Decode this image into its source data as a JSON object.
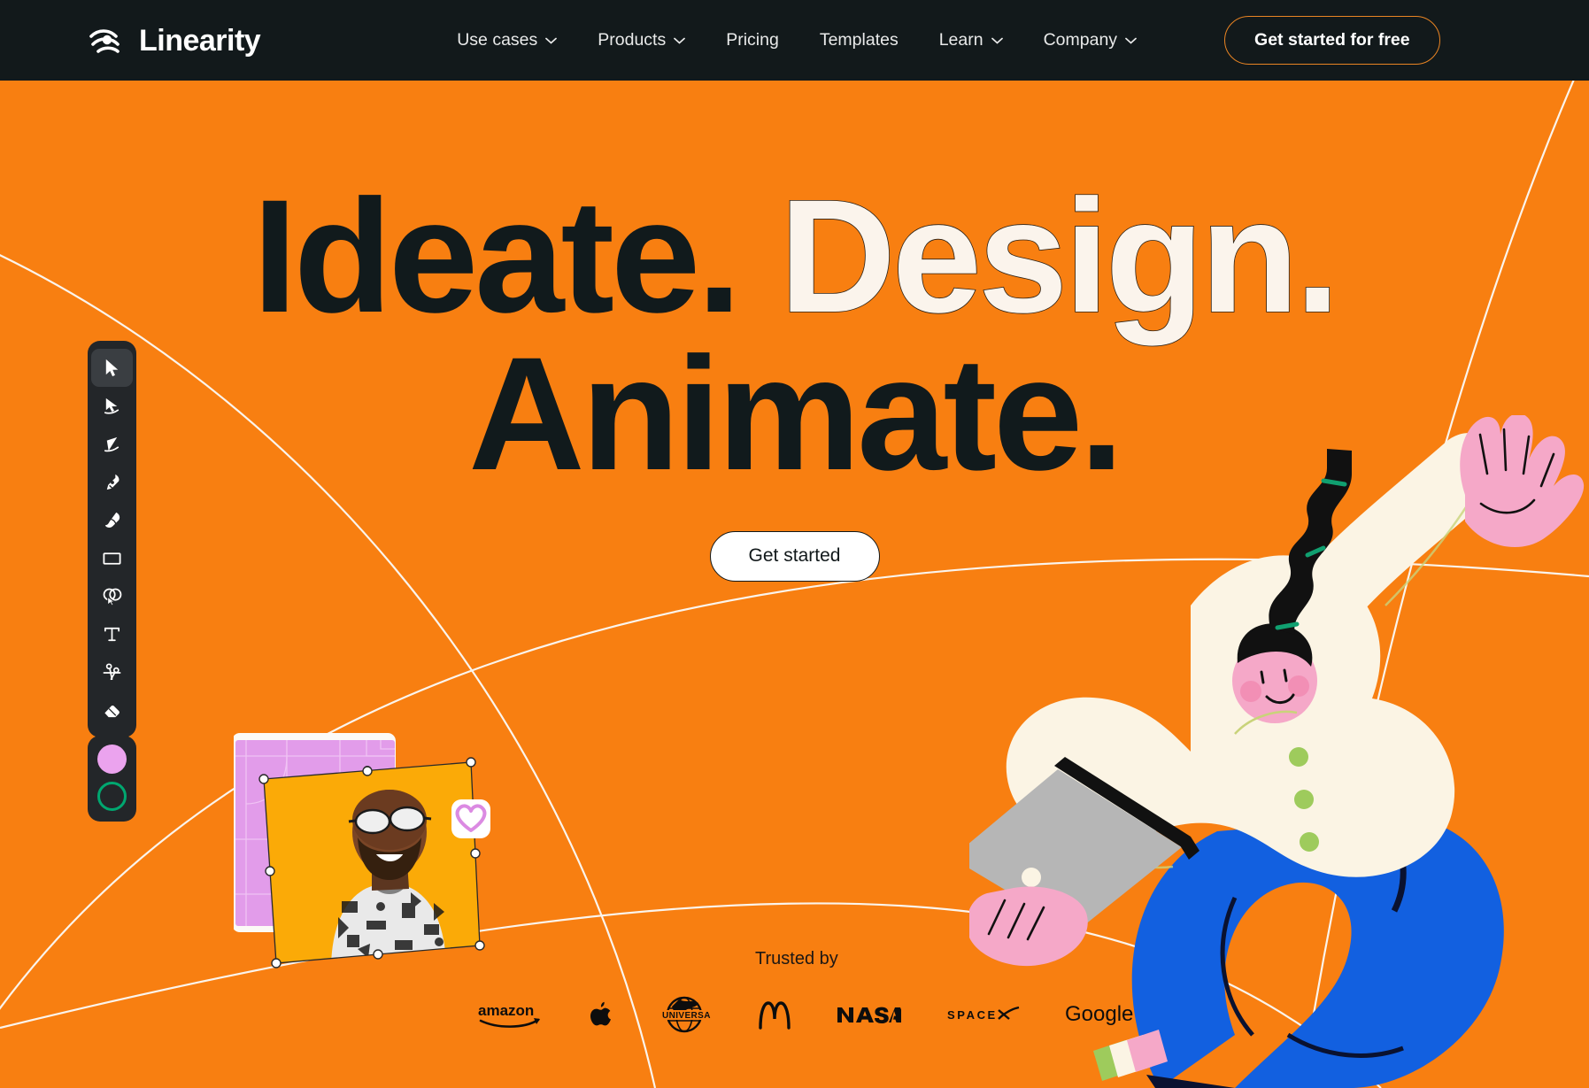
{
  "brand": {
    "name": "Linearity",
    "logo_icon": "linearity-swoosh-icon"
  },
  "colors": {
    "background_orange": "#F87F11",
    "header_dark": "#12191B",
    "headline_dark": "#111A1C",
    "headline_cream": "#FBF4EC",
    "cta_outline_border": "#E98423",
    "swatch_fill_pink": "#EBA3EE",
    "swatch_stroke_green": "#00A770",
    "illustration_blue": "#1260E0",
    "illustration_pink": "#F5A8C8",
    "photo_card_yellow": "#FBAA07",
    "grid_card_violet": "#E29CEA"
  },
  "header": {
    "nav_items": [
      {
        "label": "Use cases",
        "has_dropdown": true,
        "icon": "chevron-down-icon"
      },
      {
        "label": "Products",
        "has_dropdown": true,
        "icon": "chevron-down-icon"
      },
      {
        "label": "Pricing",
        "has_dropdown": false,
        "icon": ""
      },
      {
        "label": "Templates",
        "has_dropdown": false,
        "icon": ""
      },
      {
        "label": "Learn",
        "has_dropdown": true,
        "icon": "chevron-down-icon"
      },
      {
        "label": "Company",
        "has_dropdown": true,
        "icon": "chevron-down-icon"
      }
    ],
    "cta_label": "Get started for free"
  },
  "hero": {
    "line1_word1": "Ideate.",
    "line1_word2": "Design.",
    "line2": "Animate.",
    "cta_label": "Get started"
  },
  "toolbar": {
    "tools": [
      {
        "name": "selection-tool",
        "icon": "cursor-arrow-icon",
        "active": true
      },
      {
        "name": "node-tool",
        "icon": "direct-select-arrow-icon",
        "active": false
      },
      {
        "name": "lasso-tool",
        "icon": "lasso-triangle-icon",
        "active": false
      },
      {
        "name": "pen-tool",
        "icon": "pen-nib-icon",
        "active": false
      },
      {
        "name": "brush-tool",
        "icon": "paint-brush-icon",
        "active": false
      },
      {
        "name": "rectangle-tool",
        "icon": "rectangle-icon",
        "active": false
      },
      {
        "name": "shape-builder-tool",
        "icon": "shape-builder-icon",
        "active": false
      },
      {
        "name": "text-tool",
        "icon": "text-t-icon",
        "active": false
      },
      {
        "name": "scissors-tool",
        "icon": "scissors-icon",
        "active": false
      },
      {
        "name": "eraser-tool",
        "icon": "eraser-icon",
        "active": false
      }
    ],
    "swatches": [
      {
        "name": "fill-color-swatch",
        "type": "fill",
        "color": "#EBA3EE"
      },
      {
        "name": "stroke-color-swatch",
        "type": "stroke",
        "color": "#00A770"
      }
    ]
  },
  "canvas_cards": {
    "back_card": "white-card",
    "middle_card": "violet-grid-card",
    "front_card": "selected-photo-card",
    "badge_icon": "heart-icon",
    "selection_handles": 8
  },
  "trusted": {
    "label": "Trusted by",
    "logos": [
      {
        "name": "amazon",
        "icon": "amazon-wordmark-icon"
      },
      {
        "name": "Apple",
        "icon": "apple-logo-icon"
      },
      {
        "name": "UNIVERSAL",
        "icon": "universal-globe-icon"
      },
      {
        "name": "McDonald's",
        "icon": "mcdonalds-arches-icon"
      },
      {
        "name": "NASA",
        "icon": "nasa-worm-icon"
      },
      {
        "name": "SPACEX",
        "icon": "spacex-wordmark-icon"
      },
      {
        "name": "Google",
        "icon": "google-wordmark-icon"
      }
    ]
  },
  "illustration": {
    "name": "waving-person-with-tablet",
    "alt": "Illustrated person waving with raised hand holding a tablet"
  }
}
